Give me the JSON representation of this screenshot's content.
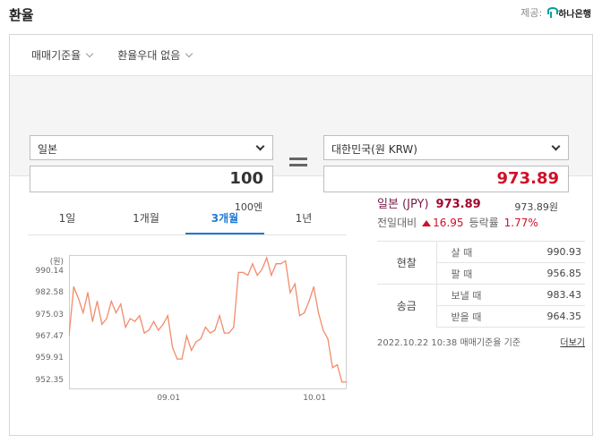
{
  "header": {
    "title": "환율",
    "provider_label": "제공:",
    "provider_name": "하나은행"
  },
  "toolbar": {
    "rate_basis": "매매기준율",
    "preferential": "환율우대 없음"
  },
  "converter": {
    "from_currency": "일본",
    "from_amount": "100",
    "from_sub": "100엔",
    "to_currency": "대한민국(원 KRW)",
    "to_amount": "973.89",
    "to_sub": "973.89원"
  },
  "tabs": [
    "1일",
    "1개월",
    "3개월",
    "1년"
  ],
  "active_tab": "3개월",
  "info": {
    "currency": "일본 (JPY)",
    "rate": "973.89",
    "change_label": "전일대비",
    "change_value": "16.95",
    "pct_label": "등락률",
    "pct_value": "1.77%",
    "cash_label": "현찰",
    "remit_label": "송금",
    "buy_label": "살 때",
    "sell_label": "팔 때",
    "send_label": "보낼 때",
    "receive_label": "받을 때",
    "cash_buy": "990.93",
    "cash_sell": "956.85",
    "send": "983.43",
    "receive": "964.35",
    "timestamp": "2022.10.22 10:38",
    "basis_note": "매매기준율 기준",
    "more_label": "더보기"
  },
  "chart_data": {
    "type": "line",
    "ylabel": "(원)",
    "yticks": [
      "990.14",
      "982.58",
      "975.03",
      "967.47",
      "959.91",
      "952.35"
    ],
    "ytick_values": [
      990.14,
      982.58,
      975.03,
      967.47,
      959.91,
      952.35
    ],
    "ylim": [
      949.5,
      996.0
    ],
    "xticks": [
      "09.01",
      "10.01"
    ],
    "xtick_index": [
      21,
      52
    ],
    "color": "#f28b6b",
    "values": [
      968,
      985,
      981,
      976,
      983,
      973,
      980,
      972,
      974,
      980,
      976,
      979,
      971,
      974,
      973,
      975,
      969,
      970,
      973,
      970,
      972,
      975,
      964,
      960,
      960,
      968,
      963,
      966,
      967,
      971,
      969,
      970,
      975,
      969,
      969,
      971,
      990,
      990,
      989,
      993,
      989,
      991,
      995,
      989,
      993,
      993,
      994,
      983,
      986,
      975,
      976,
      980,
      985,
      976,
      970,
      967,
      957,
      958,
      952,
      952
    ]
  }
}
